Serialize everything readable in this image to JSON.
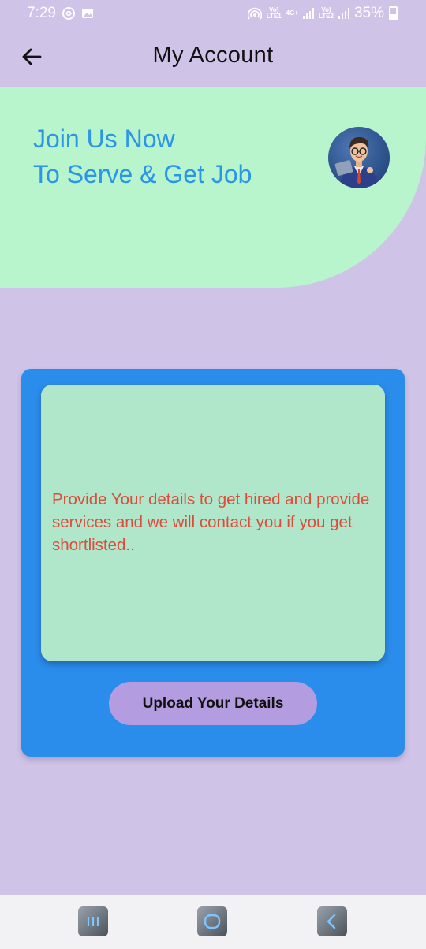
{
  "status_bar": {
    "time": "7:29",
    "network_top": "Vo)",
    "network_lte1": "LTE1",
    "network_4g": "4G+",
    "network_top2": "Vo)",
    "network_lte2": "LTE2",
    "battery": "35%"
  },
  "app_bar": {
    "title": "My Account",
    "back_icon": "arrow-left-icon"
  },
  "hero": {
    "line1": "Join Us Now",
    "line2": "To Serve & Get Job",
    "accent_color": "#2b95e8",
    "background_color": "#b8f4cc",
    "avatar_icon": "businessman-avatar-icon"
  },
  "card": {
    "message": "Provide Your details to get hired and provide services and we will contact you if you get shortlisted..",
    "button_label": "Upload Your Details",
    "card_color": "#2a8ceb",
    "inner_color": "#b0e6c9",
    "message_color": "#e14a3a",
    "button_color": "#b39ce0"
  },
  "nav_bar": {
    "recent_icon": "recent-apps-icon",
    "home_icon": "home-icon",
    "back_icon": "back-icon"
  }
}
